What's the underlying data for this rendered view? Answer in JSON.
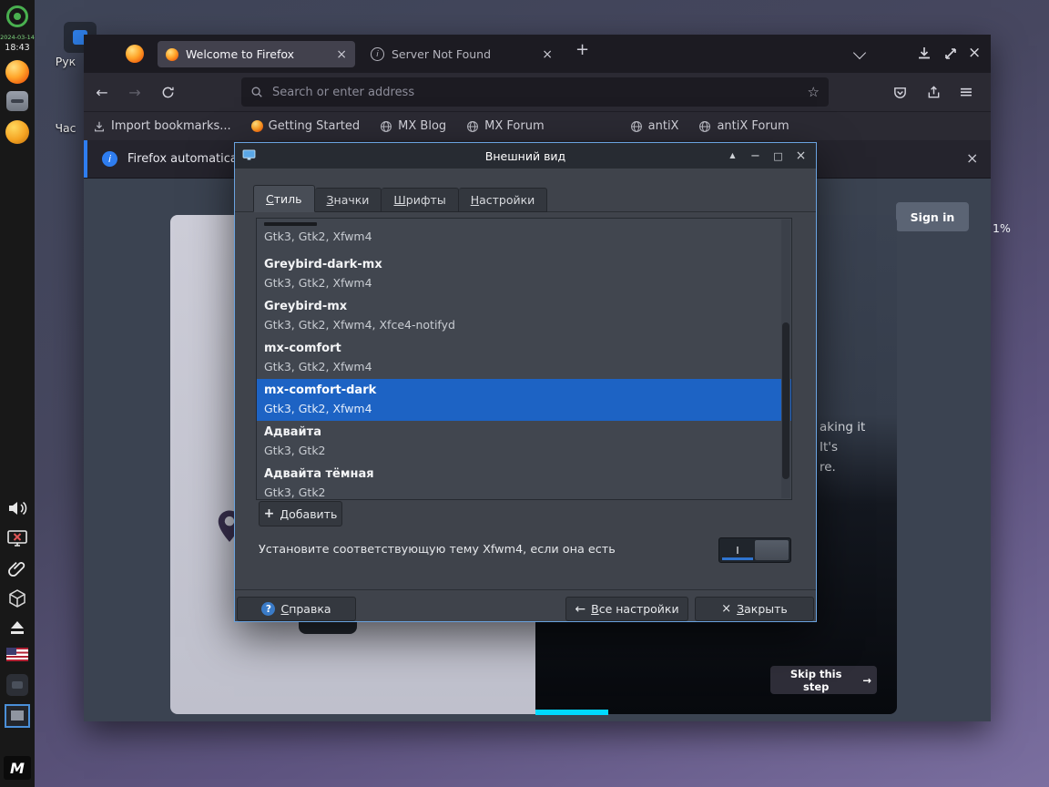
{
  "panel": {
    "clock_date": "2024-03-14",
    "clock_time": "18:43",
    "mx_logo": "M"
  },
  "desktop": {
    "volume_osd": "1%",
    "icon_labels": [
      "Рук",
      "Час"
    ]
  },
  "firefox": {
    "tabs": [
      {
        "title": "Welcome to Firefox"
      },
      {
        "title": "Server Not Found"
      }
    ],
    "urlbar_placeholder": "Search or enter address",
    "bookmarks": [
      "Import bookmarks...",
      "Getting Started",
      "MX Blog",
      "MX Forum",
      "antiX",
      "antiX Forum"
    ],
    "notification_text": "Firefox automatica",
    "page": {
      "signin_label": "Sign in",
      "skip_label": "Skip this step",
      "fragments": [
        "aking it",
        "It's",
        "re."
      ]
    }
  },
  "dialog": {
    "title": "Внешний вид",
    "tabs": [
      "Стиль",
      "Значки",
      "Шрифты",
      "Настройки"
    ],
    "themes": [
      {
        "details": "Gtk3, Gtk2, Xfwm4"
      },
      {
        "name": "Greybird-dark-mx",
        "details": "Gtk3, Gtk2, Xfwm4"
      },
      {
        "name": "Greybird-mx",
        "details": "Gtk3, Gtk2, Xfwm4, Xfce4-notifyd"
      },
      {
        "name": "mx-comfort",
        "details": "Gtk3, Gtk2, Xfwm4"
      },
      {
        "name": "mx-comfort-dark",
        "details": "Gtk3, Gtk2, Xfwm4"
      },
      {
        "name": "Адвайта",
        "details": "Gtk3, Gtk2"
      },
      {
        "name": "Адвайта тёмная",
        "details": "Gtk3, Gtk2"
      }
    ],
    "selected_theme": "mx-comfort-dark",
    "add_label": "Добавить",
    "switch_label": "Установите соответствующую тему Xfwm4, если она есть",
    "help_label": "Справка",
    "all_settings_label": "Все настройки",
    "close_label": "Закрыть"
  },
  "icons": {
    "back": "←",
    "forward": "→",
    "star": "☆",
    "menu": "≡",
    "new_tab": "+",
    "close": "×",
    "shade": "▲",
    "minimize": "−",
    "maximize": "□",
    "plus": "+",
    "question": "?",
    "info": "i",
    "left_arrow": "←",
    "right_arrow": "→",
    "switch_on": "I"
  }
}
